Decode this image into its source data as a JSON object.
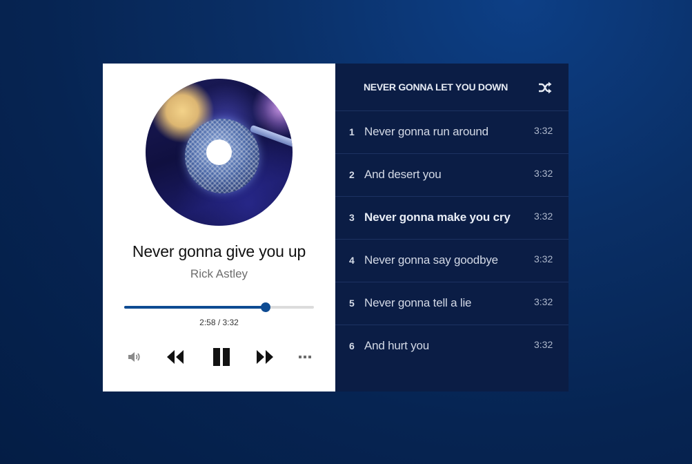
{
  "player": {
    "cover_icon": "album-art-microphone",
    "title": "Never gonna give you up",
    "artist": "Rick Astley",
    "progress_fraction": 0.746,
    "time_display": "2:58 / 3:32",
    "controls": {
      "volume_icon": "volume-icon",
      "rewind_icon": "rewind-icon",
      "pause_icon": "pause-icon",
      "forward_icon": "fast-forward-icon",
      "more_icon": "more-icon"
    },
    "accent_color": "#0e4b92"
  },
  "playlist": {
    "title": "NEVER GONNA LET YOU DOWN",
    "shuffle_icon": "shuffle-icon",
    "background_color": "#0b1d45",
    "tracks": [
      {
        "number": "1",
        "name": "Never gonna run around",
        "duration": "3:32",
        "active": false
      },
      {
        "number": "2",
        "name": "And desert you",
        "duration": "3:32",
        "active": false
      },
      {
        "number": "3",
        "name": "Never gonna make you cry",
        "duration": "3:32",
        "active": true
      },
      {
        "number": "4",
        "name": "Never gonna say goodbye",
        "duration": "3:32",
        "active": false
      },
      {
        "number": "5",
        "name": "Never gonna tell a lie",
        "duration": "3:32",
        "active": false
      },
      {
        "number": "6",
        "name": "And hurt you",
        "duration": "3:32",
        "active": false
      }
    ]
  }
}
